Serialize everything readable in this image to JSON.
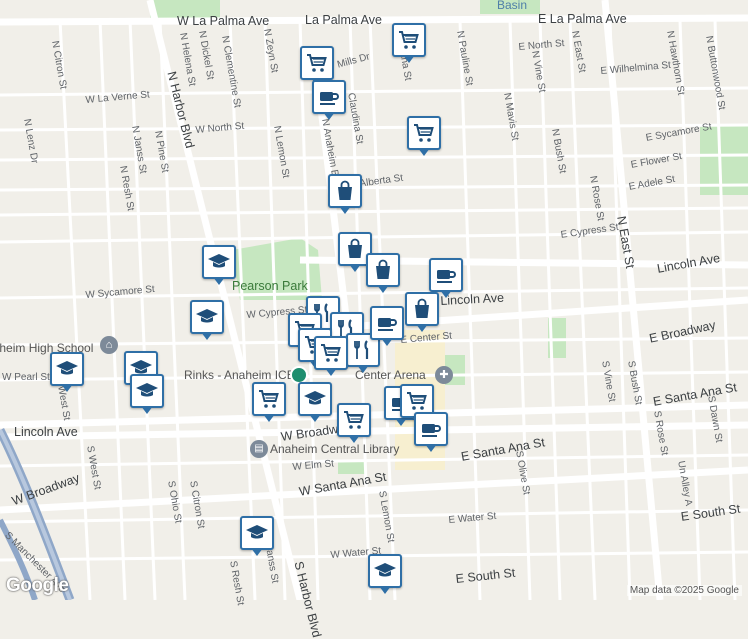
{
  "map": {
    "attribution": "Map data ©2025 Google",
    "logo": "Google",
    "colors": {
      "background": "#f1efe9",
      "road": "#ffffff",
      "major_road": "#ffffff",
      "park": "#c6e7c0",
      "water": "#a8cbe6",
      "freeway": "#8fa7c8",
      "marker_border": "#2f6fa6",
      "marker_icon": "#1f4e79"
    }
  },
  "streets": [
    {
      "name": "W La Palma Ave"
    },
    {
      "name": "La Palma Ave"
    },
    {
      "name": "E La Palma Ave"
    },
    {
      "name": "N Citron St"
    },
    {
      "name": "N Helena St"
    },
    {
      "name": "N Dickel St"
    },
    {
      "name": "N Clementine St"
    },
    {
      "name": "N Zeyn St"
    },
    {
      "name": "Mills Dr"
    },
    {
      "name": "Ana St"
    },
    {
      "name": "N Pauline St"
    },
    {
      "name": "E North St"
    },
    {
      "name": "N Vine St"
    },
    {
      "name": "N East St"
    },
    {
      "name": "N Hawthorn St"
    },
    {
      "name": "N Buttonwood St"
    },
    {
      "name": "E Wilhelmina St"
    },
    {
      "name": "W La Verne St"
    },
    {
      "name": "N Lenz Dr"
    },
    {
      "name": "N Harbor Blvd"
    },
    {
      "name": "N Mavis St"
    },
    {
      "name": "N Bush St"
    },
    {
      "name": "W North St"
    },
    {
      "name": "N Pine St"
    },
    {
      "name": "N Janss St"
    },
    {
      "name": "N Resh St"
    },
    {
      "name": "N Lemon St"
    },
    {
      "name": "N Anaheim Blvd"
    },
    {
      "name": "Claudina St"
    },
    {
      "name": "E Sycamore St"
    },
    {
      "name": "E Flower St"
    },
    {
      "name": "E Adele St"
    },
    {
      "name": "E Alberta St"
    },
    {
      "name": "N Rose St"
    },
    {
      "name": "E Cypress St"
    },
    {
      "name": "N East St"
    },
    {
      "name": "Lincoln Ave"
    },
    {
      "name": "W Sycamore St"
    },
    {
      "name": "W Cypress St"
    },
    {
      "name": "Lincoln Ave"
    },
    {
      "name": "E Center St"
    },
    {
      "name": "E Broadway"
    },
    {
      "name": "W Pearl St"
    },
    {
      "name": "West St"
    },
    {
      "name": "S Vine St"
    },
    {
      "name": "S Bush St"
    },
    {
      "name": "E Santa Ana St"
    },
    {
      "name": "S Dawn St"
    },
    {
      "name": "S Rose St"
    },
    {
      "name": "Lincoln Ave"
    },
    {
      "name": "W Broadway"
    },
    {
      "name": "S West St"
    },
    {
      "name": "W Elm St"
    },
    {
      "name": "E Santa Ana St"
    },
    {
      "name": "S Olive St"
    },
    {
      "name": "Un Alley A"
    },
    {
      "name": "W Broadway"
    },
    {
      "name": "W Santa Ana St"
    },
    {
      "name": "S Ohio St"
    },
    {
      "name": "S Citron St"
    },
    {
      "name": "S Lemon St"
    },
    {
      "name": "E Water St"
    },
    {
      "name": "E South St"
    },
    {
      "name": "S Janss St"
    },
    {
      "name": "W Water St"
    },
    {
      "name": "S Resh St"
    },
    {
      "name": "S Harbor Blvd"
    },
    {
      "name": "E South St"
    },
    {
      "name": "S Manchester Ave"
    }
  ],
  "places": [
    {
      "name": "Pearson Park"
    },
    {
      "name": "Anaheim High School"
    },
    {
      "name": "Rinks - Anaheim ICE"
    },
    {
      "name": "Anaheim Central Library"
    },
    {
      "name": "Center Arena"
    },
    {
      "name": "Basin"
    }
  ],
  "markers": [
    {
      "icon": "shopping-cart-icon"
    },
    {
      "icon": "shopping-cart-icon"
    },
    {
      "icon": "coffee-cup-icon"
    },
    {
      "icon": "shopping-cart-icon"
    },
    {
      "icon": "shopping-bag-icon"
    },
    {
      "icon": "shopping-bag-icon"
    },
    {
      "icon": "shopping-bag-icon"
    },
    {
      "icon": "coffee-cup-icon"
    },
    {
      "icon": "graduation-cap-icon"
    },
    {
      "icon": "graduation-cap-icon"
    },
    {
      "icon": "restaurant-icon"
    },
    {
      "icon": "shopping-cart-icon"
    },
    {
      "icon": "shopping-bag-icon"
    },
    {
      "icon": "restaurant-icon"
    },
    {
      "icon": "shopping-cart-icon"
    },
    {
      "icon": "restaurant-icon"
    },
    {
      "icon": "shopping-cart-icon"
    },
    {
      "icon": "coffee-cup-icon"
    },
    {
      "icon": "graduation-cap-icon"
    },
    {
      "icon": "graduation-cap-icon"
    },
    {
      "icon": "graduation-cap-icon"
    },
    {
      "icon": "shopping-cart-icon"
    },
    {
      "icon": "graduation-cap-icon"
    },
    {
      "icon": "shopping-cart-icon"
    },
    {
      "icon": "coffee-cup-icon"
    },
    {
      "icon": "shopping-cart-icon"
    },
    {
      "icon": "coffee-cup-icon"
    },
    {
      "icon": "graduation-cap-icon"
    },
    {
      "icon": "graduation-cap-icon"
    }
  ]
}
